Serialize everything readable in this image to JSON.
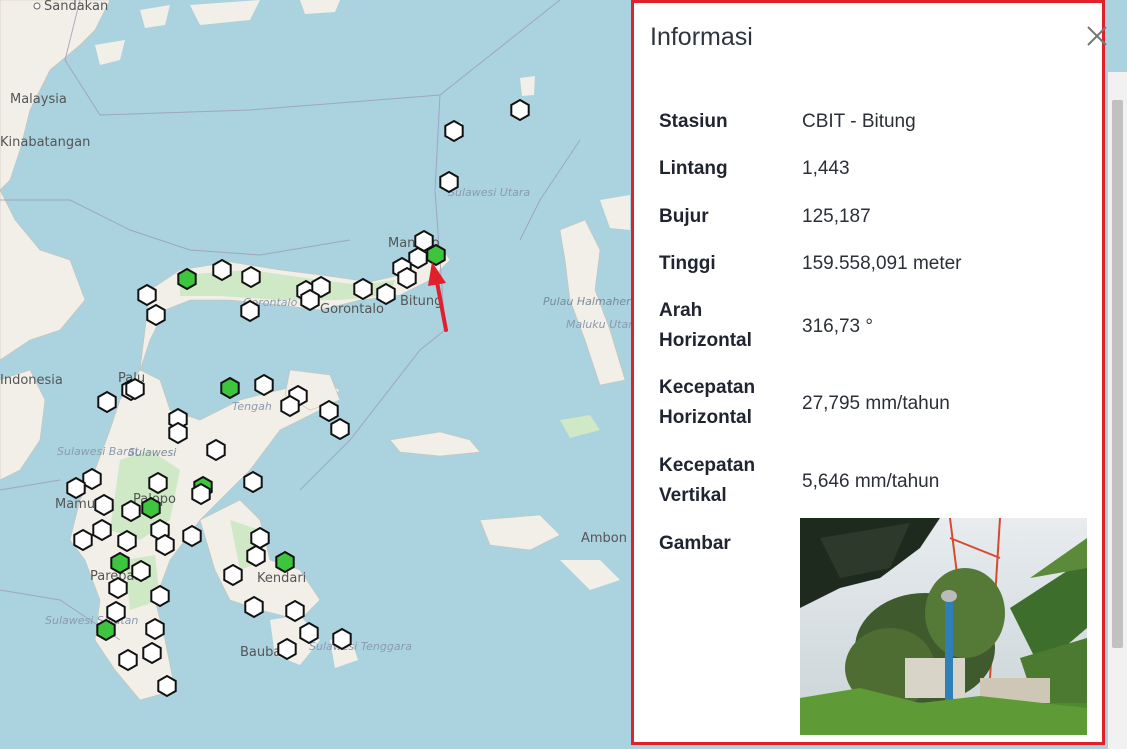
{
  "map": {
    "places": [
      "Sandakan",
      "Malaysia",
      "Sulawesi Utara",
      "Manado",
      "Bitung",
      "Gorontalo",
      "Gorontalo",
      "Pulau Halmahera",
      "Maluku Utara",
      "Palu",
      "Tengah",
      "Sulawesi",
      "Sulawesi Barat",
      "Mamuju",
      "Palopo",
      "Parepare",
      "Sulawesi Selatan",
      "Kendari",
      "Baubau",
      "Sulawesi Tenggara",
      "Ambon",
      "Kinabatangan",
      "Indonesia"
    ],
    "station_colors": {
      "default": "#ffffff",
      "highlight": "#3ec53e",
      "outline": "#111111"
    },
    "arrow_color": "#e0202b"
  },
  "panel": {
    "title": "Informasi",
    "close_icon": "close-icon",
    "fields": [
      {
        "label": "Stasiun",
        "value": "CBIT - Bitung"
      },
      {
        "label": "Lintang",
        "value": "1,443"
      },
      {
        "label": "Bujur",
        "value": "125,187"
      },
      {
        "label": "Tinggi",
        "value": "159.558,091 meter"
      },
      {
        "label_lines": [
          "Arah",
          "Horizontal"
        ],
        "value": "316,73 °"
      },
      {
        "label_lines": [
          "Kecepatan",
          "Horizontal"
        ],
        "value": "27,795 mm/tahun"
      },
      {
        "label_lines": [
          "Kecepatan",
          "Vertikal"
        ],
        "value": "5,646 mm/tahun"
      },
      {
        "label": "Gambar"
      }
    ],
    "photo_name": "station-photo"
  }
}
